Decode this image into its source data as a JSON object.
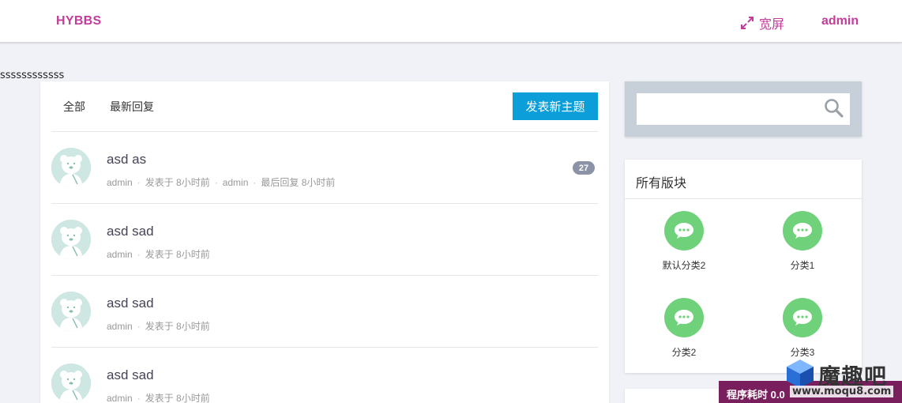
{
  "header": {
    "brand": "HYBBS",
    "wide_label": "宽屏",
    "username": "admin",
    "accent_color": "#c23c9a"
  },
  "stray_text": "ssssssssssss",
  "tabs": {
    "all": "全部",
    "latest_reply": "最新回复",
    "new_topic": "发表新主题"
  },
  "topics": [
    {
      "title": "asd as",
      "author": "admin",
      "posted": "发表于 8小时前",
      "last_author": "admin",
      "last_reply": "最后回复 8小时前",
      "reply_count": "27"
    },
    {
      "title": "asd sad",
      "author": "admin",
      "posted": "发表于 8小时前"
    },
    {
      "title": "asd sad",
      "author": "admin",
      "posted": "发表于 8小时前"
    },
    {
      "title": "asd sad",
      "author": "admin",
      "posted": "发表于 8小时前"
    }
  ],
  "search": {
    "placeholder": "",
    "icon": "search-icon"
  },
  "forums": {
    "title": "所有版块",
    "items": [
      {
        "name": "默认分类2",
        "icon": "chat-bubble-icon"
      },
      {
        "name": "分类1",
        "icon": "chat-bubble-icon"
      },
      {
        "name": "分类2",
        "icon": "chat-bubble-icon"
      },
      {
        "name": "分类3",
        "icon": "chat-bubble-icon"
      }
    ]
  },
  "footer": {
    "timing": "程序耗时 0.0"
  },
  "watermark": {
    "brand": "魔趣吧",
    "url": "www.moqu8.com"
  },
  "colors": {
    "primary_button": "#0b9ed8",
    "forum_icon": "#6fd27a",
    "badge": "#8c93a6",
    "timing_bar": "#7a1f5d"
  }
}
